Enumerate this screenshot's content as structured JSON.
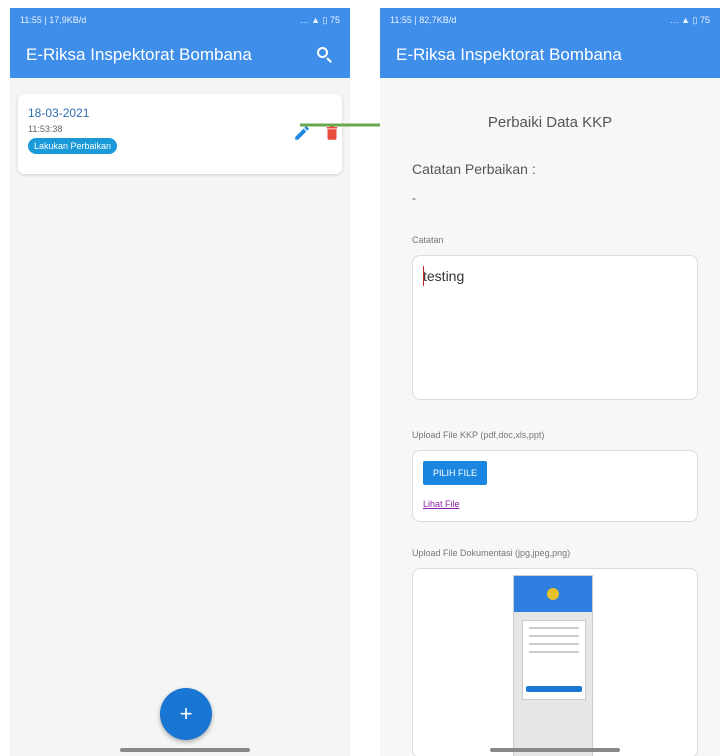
{
  "left_screen": {
    "status_time": "11:55 | 17,9KB/d",
    "status_right": "… ▲ ▯ 75",
    "app_title": "E-Riksa Inspektorat Bombana",
    "card": {
      "date": "18-03-2021",
      "time": "11:53:38",
      "badge": "Lakukan Perbaikan"
    },
    "fab_label": "+"
  },
  "right_screen": {
    "status_time": "11:55 | 82,7KB/d",
    "status_right": "… ▲ ▯ 75",
    "app_title": "E-Riksa Inspektorat Bombana",
    "page_title": "Perbaiki Data KKP",
    "catatan_perbaikan_label": "Catatan Perbaikan :",
    "catatan_perbaikan_value": "-",
    "catatan_label": "Catatan",
    "catatan_value": "testing",
    "upload_kkp_label": "Upload File KKP (pdf,doc,xls,ppt)",
    "pick_file_label": "PILIH FILE",
    "view_file_label": "Lihat File",
    "upload_doc_label": "Upload File Dokumentasi (jpg,jpeg,png)"
  },
  "colors": {
    "appbar": "#3f8ee9",
    "fab": "#1976d2",
    "arrow": "#6aa84f",
    "delete": "#e74c3c",
    "edit": "#1e88e5"
  }
}
